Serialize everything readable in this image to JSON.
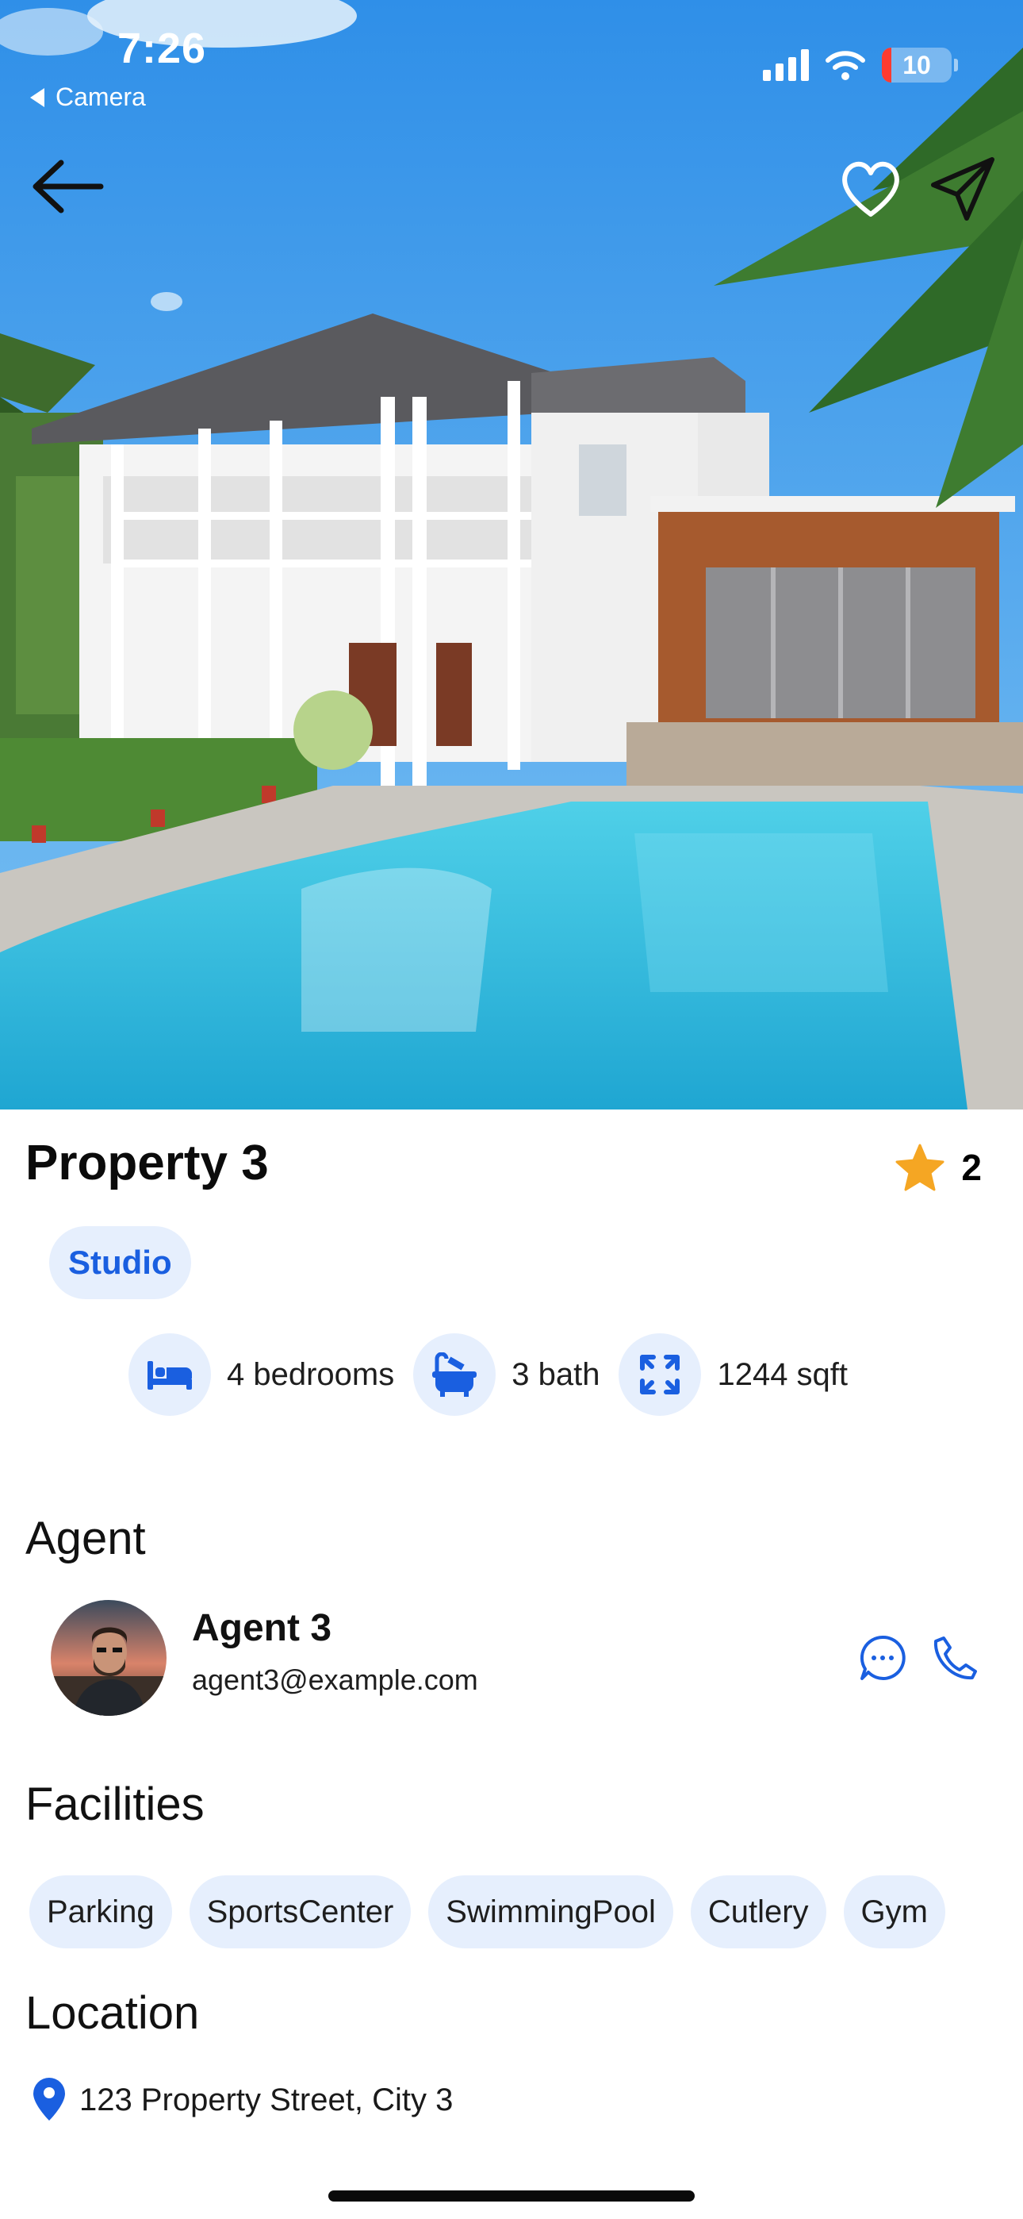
{
  "status_bar": {
    "time": "7:26",
    "back_app": "Camera",
    "battery": "10"
  },
  "property": {
    "title": "Property 3",
    "rating": "2",
    "type": "Studio",
    "stats": {
      "bedrooms": "4 bedrooms",
      "bath": "3 bath",
      "area": "1244 sqft"
    }
  },
  "agent": {
    "section_title": "Agent",
    "name": "Agent 3",
    "email": "agent3@example.com"
  },
  "facilities": {
    "section_title": "Facilities",
    "items": [
      "Parking",
      "SportsCenter",
      "SwimmingPool",
      "Cutlery",
      "Gym"
    ]
  },
  "location": {
    "section_title": "Location",
    "address": "123 Property Street, City 3"
  },
  "colors": {
    "accent": "#1a5fe0",
    "chip_bg": "#e6effd",
    "star": "#f5a623"
  },
  "icons": [
    "back-arrow-icon",
    "heart-icon",
    "send-icon",
    "star-icon",
    "bed-icon",
    "bathtub-icon",
    "expand-icon",
    "chat-icon",
    "phone-icon",
    "location-pin-icon"
  ]
}
